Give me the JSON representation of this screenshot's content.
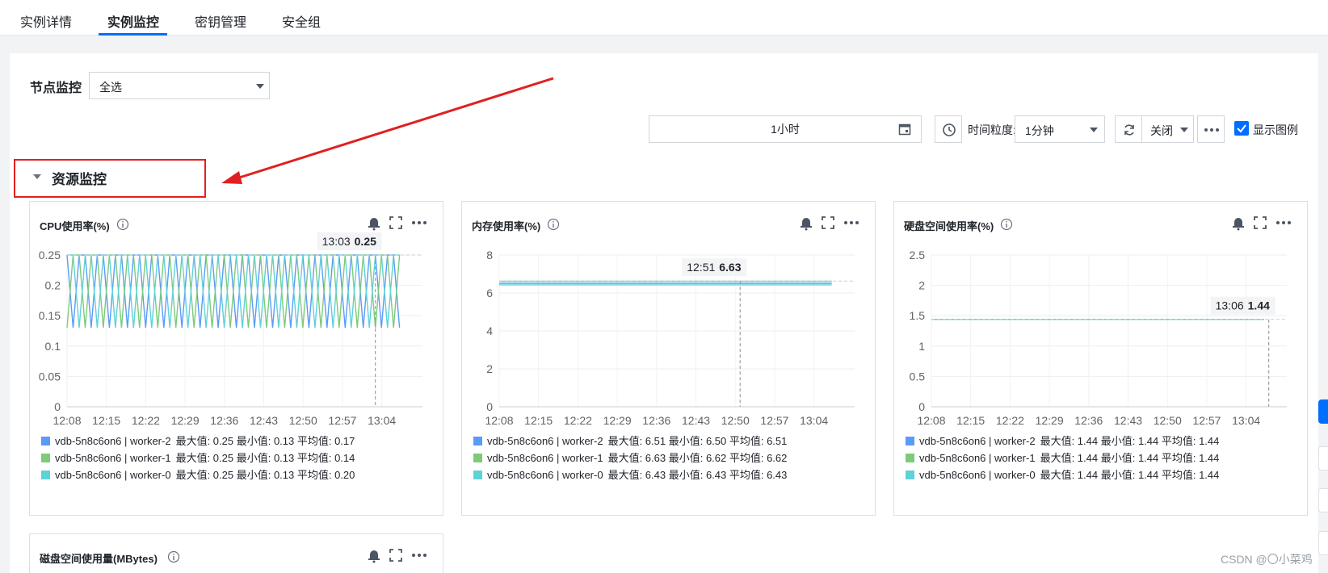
{
  "tabs": [
    {
      "label": "实例详情",
      "active": false
    },
    {
      "label": "实例监控",
      "active": true
    },
    {
      "label": "密钥管理",
      "active": false
    },
    {
      "label": "安全组",
      "active": false
    }
  ],
  "node_monitor": {
    "label": "节点监控",
    "selected": "全选"
  },
  "toolbar": {
    "time_range": "1小时",
    "granularity_label": "时间粒度:",
    "granularity_value": "1分钟",
    "refresh_value": "关闭",
    "show_legend_label": "显示图例",
    "show_legend_checked": true
  },
  "section": {
    "title": "资源监控"
  },
  "series_colors": {
    "worker-2": "#5b9bf8",
    "worker-1": "#7ccb7a",
    "worker-0": "#5fd1d8"
  },
  "chart_data": [
    {
      "type": "line",
      "title": "CPU使用率(%)",
      "x": [
        "12:08",
        "12:15",
        "12:22",
        "12:29",
        "12:36",
        "12:43",
        "12:50",
        "12:57",
        "13:04"
      ],
      "ylim": [
        0,
        0.25
      ],
      "yticks": [
        "0",
        "0.05",
        "0.1",
        "0.15",
        "0.2",
        "0.25"
      ],
      "tooltip": {
        "time": "13:03",
        "value": "0.25"
      },
      "series": [
        {
          "name": "vdb-5n8c6on6 | worker-2",
          "stats": "最大值: 0.25  最小值: 0.13  平均值: 0.17",
          "min": 0.13,
          "max": 0.25
        },
        {
          "name": "vdb-5n8c6on6 | worker-1",
          "stats": "最大值: 0.25  最小值: 0.13  平均值: 0.14",
          "min": 0.13,
          "max": 0.25
        },
        {
          "name": "vdb-5n8c6on6 | worker-0",
          "stats": "最大值: 0.25  最小值: 0.13  平均值: 0.20",
          "min": 0.13,
          "max": 0.25
        }
      ]
    },
    {
      "type": "line",
      "title": "内存使用率(%)",
      "x": [
        "12:08",
        "12:15",
        "12:22",
        "12:29",
        "12:36",
        "12:43",
        "12:50",
        "12:57",
        "13:04"
      ],
      "ylim": [
        0,
        8
      ],
      "yticks": [
        "0",
        "2",
        "4",
        "6",
        "8"
      ],
      "tooltip": {
        "time": "12:51",
        "value": "6.63"
      },
      "series": [
        {
          "name": "vdb-5n8c6on6 | worker-2",
          "stats": "最大值: 6.51  最小值: 6.50  平均值: 6.51",
          "value": 6.51
        },
        {
          "name": "vdb-5n8c6on6 | worker-1",
          "stats": "最大值: 6.63  最小值: 6.62  平均值: 6.62",
          "value": 6.62
        },
        {
          "name": "vdb-5n8c6on6 | worker-0",
          "stats": "最大值: 6.43  最小值: 6.43  平均值: 6.43",
          "value": 6.43
        }
      ]
    },
    {
      "type": "line",
      "title": "硬盘空间使用率(%)",
      "x": [
        "12:08",
        "12:15",
        "12:22",
        "12:29",
        "12:36",
        "12:43",
        "12:50",
        "12:57",
        "13:04"
      ],
      "ylim": [
        0,
        2.5
      ],
      "yticks": [
        "0",
        "0.5",
        "1",
        "1.5",
        "2",
        "2.5"
      ],
      "tooltip": {
        "time": "13:06",
        "value": "1.44"
      },
      "series": [
        {
          "name": "vdb-5n8c6on6 | worker-2",
          "stats": "最大值: 1.44  最小值: 1.44  平均值: 1.44",
          "value": 1.44
        },
        {
          "name": "vdb-5n8c6on6 | worker-1",
          "stats": "最大值: 1.44  最小值: 1.44  平均值: 1.44",
          "value": 1.44
        },
        {
          "name": "vdb-5n8c6on6 | worker-0",
          "stats": "最大值: 1.44  最小值: 1.44  平均值: 1.44",
          "value": 1.44
        }
      ]
    }
  ],
  "bottom_card": {
    "title": "磁盘空间使用量(MBytes)"
  },
  "watermark": "CSDN @〇小菜鸡"
}
